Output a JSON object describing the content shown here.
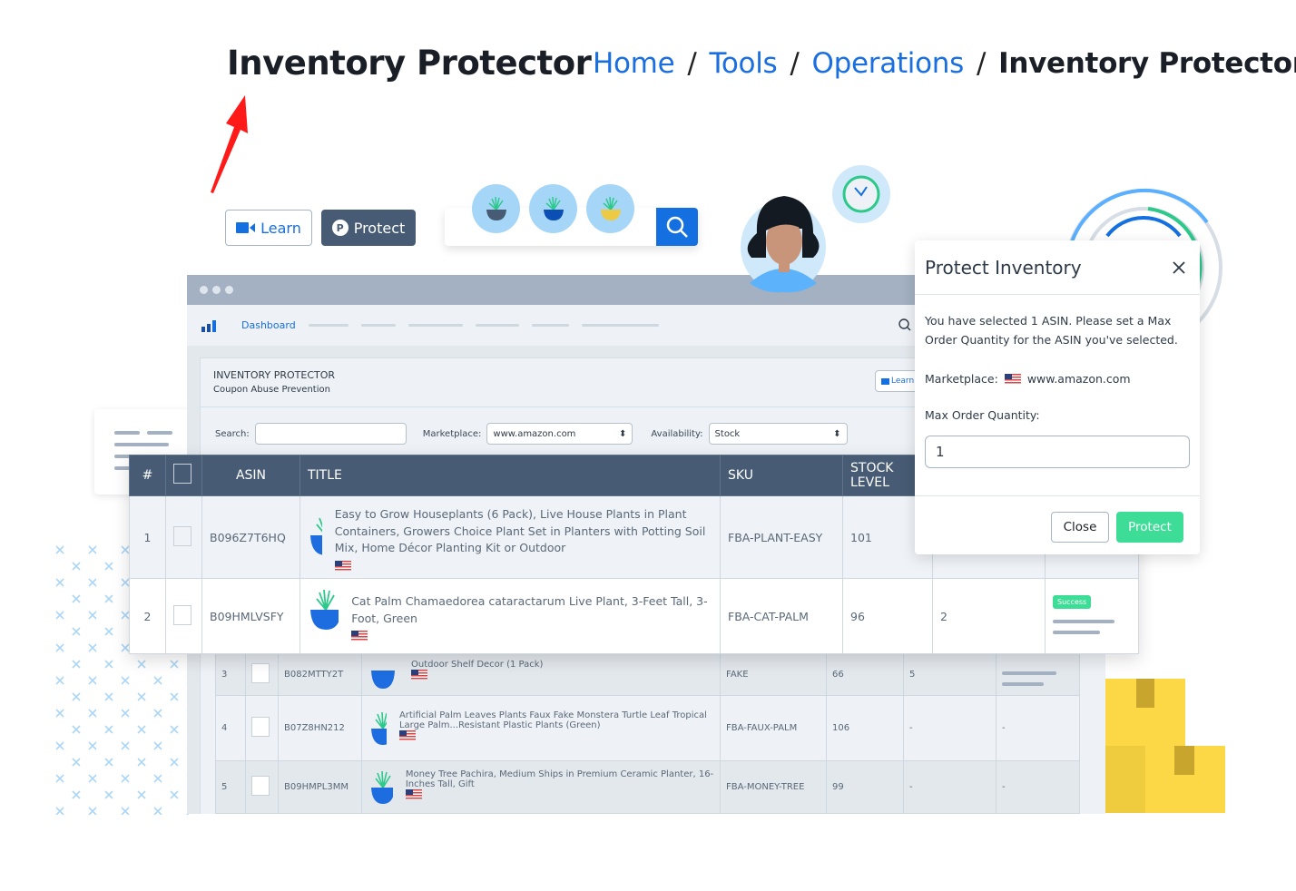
{
  "header": {
    "title": "Inventory Protector",
    "breadcrumb": [
      "Home",
      "Tools",
      "Operations",
      "Inventory Protector"
    ]
  },
  "hero": {
    "learn_label": "Learn",
    "protect_label": "Protect",
    "protect_icon_letter": "P"
  },
  "app": {
    "nav": {
      "dashboard": "Dashboard"
    },
    "card": {
      "title": "INVENTORY PROTECTOR",
      "subtitle": "Coupon Abuse Prevention",
      "learn_label": "Learn"
    },
    "filters": {
      "search_label": "Search:",
      "search_value": "",
      "marketplace_label": "Marketplace:",
      "marketplace_value": "www.amazon.com",
      "availability_label": "Availability:",
      "availability_value": "Stock"
    },
    "table": {
      "headers": [
        "#",
        "",
        "ASIN",
        "TITLE",
        "SKU",
        "STOCK LEVEL"
      ],
      "rows": [
        {
          "n": "1",
          "asin": "B096Z7T6HQ",
          "title": "Easy to Grow Houseplants (6 Pack), Live House Plants in Plant Containers, Growers Choice Plant Set in Planters with Potting Soil Mix, Home Décor Planting Kit or Outdoor",
          "sku": "FBA-PLANT-EASY",
          "stock": "101",
          "c7": "",
          "c8": ""
        },
        {
          "n": "2",
          "asin": "B09HMLVSFY",
          "title": "Cat Palm Chamaedorea cataractarum Live Plant, 3-Feet Tall, 3-Foot, Green",
          "sku": "FBA-CAT-PALM",
          "stock": "96",
          "c7": "2",
          "c8": "Success"
        },
        {
          "n": "3",
          "asin": "B082MTTY2T",
          "title": "Outdoor Shelf Decor (1 Pack)",
          "sku": "FAKE",
          "stock": "66",
          "c7": "5",
          "c8": ""
        },
        {
          "n": "4",
          "asin": "B07Z8HN212",
          "title": "Artificial Palm Leaves Plants Faux Fake Monstera Turtle Leaf Tropical Large Palm...Resistant Plastic Plants (Green)",
          "sku": "FBA-FAUX-PALM",
          "stock": "106",
          "c7": "-",
          "c8": "-"
        },
        {
          "n": "5",
          "asin": "B09HMPL3MM",
          "title": "Money Tree Pachira, Medium Ships in Premium Ceramic Planter, 16-Inches Tall, Gift",
          "sku": "FBA-MONEY-TREE",
          "stock": "99",
          "c7": "-",
          "c8": "-"
        }
      ]
    }
  },
  "modal": {
    "title": "Protect Inventory",
    "message": "You have selected 1 ASIN. Please set a Max Order Quantity for the ASIN you've selected.",
    "marketplace_label": "Marketplace:",
    "marketplace_value": "www.amazon.com",
    "qty_label": "Max Order Quantity:",
    "qty_value": "1",
    "close_label": "Close",
    "protect_label": "Protect"
  },
  "colors": {
    "accent": "#146fe0",
    "header": "#475c74",
    "success": "#3ddc97",
    "arrow": "#ff1a1a"
  }
}
